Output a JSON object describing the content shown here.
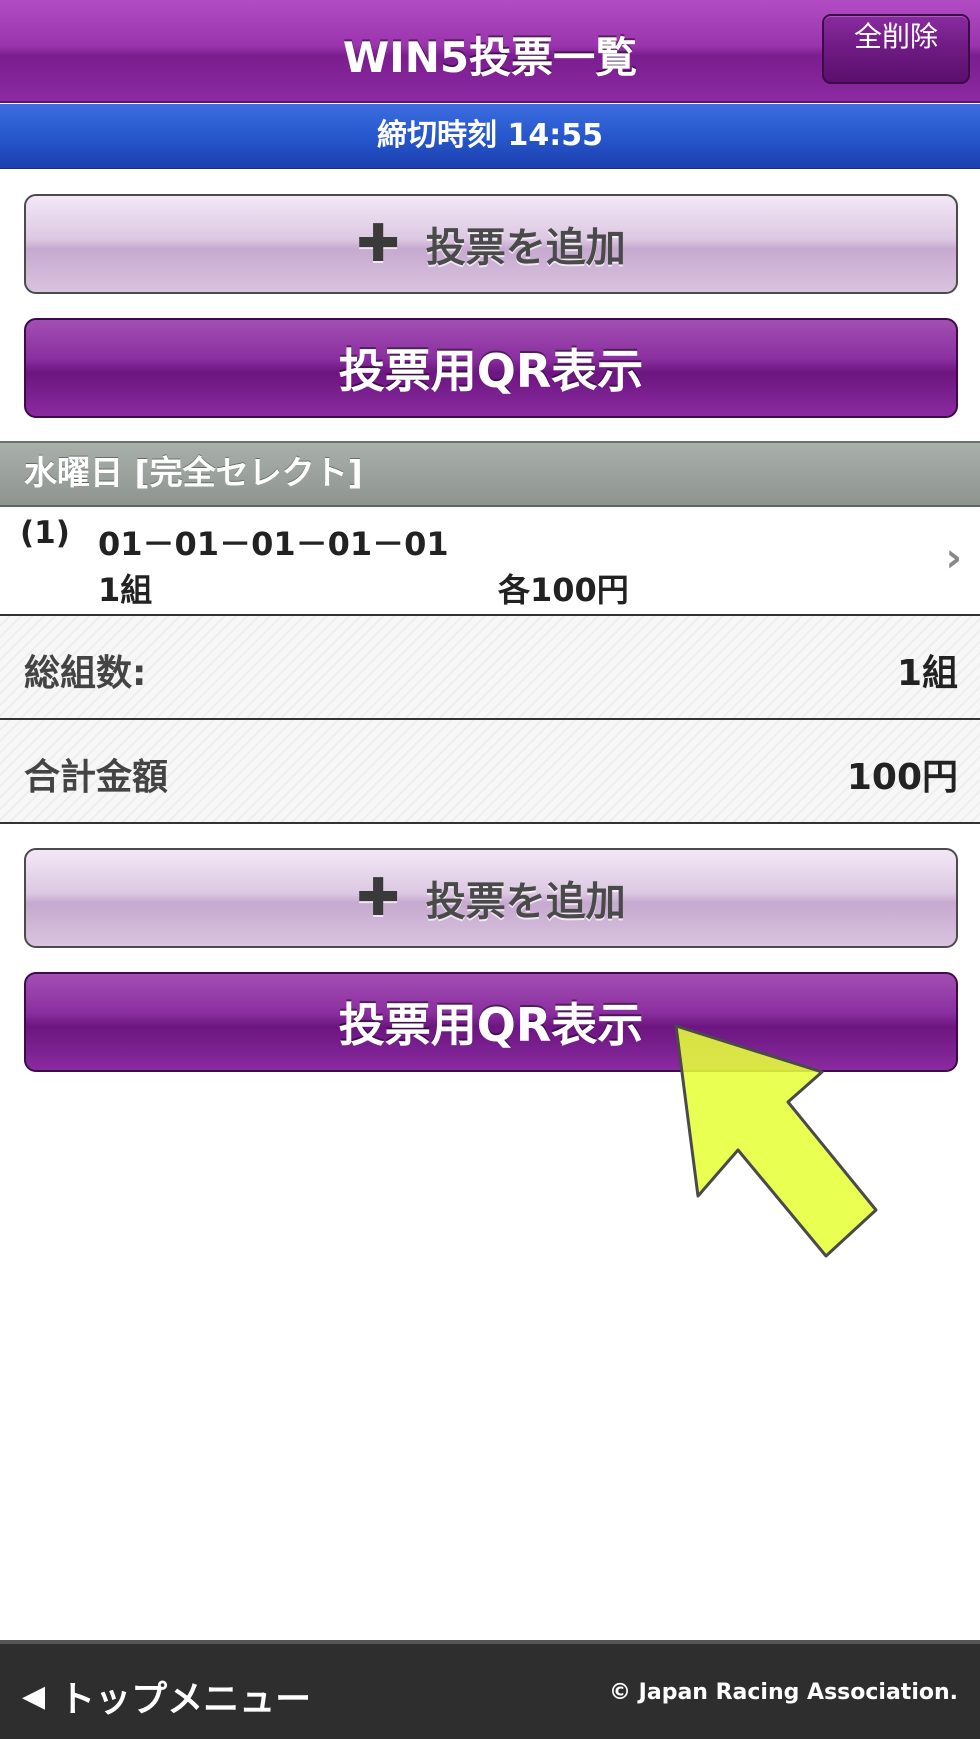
{
  "header": {
    "title": "WIN5投票一覧",
    "delete_all_label": "全削除"
  },
  "deadline": {
    "text": "締切時刻 14:55"
  },
  "actions_top": {
    "add_vote_label": "投票を追加",
    "add_icon": "plus-icon",
    "qr_label": "投票用QR表示"
  },
  "section": {
    "title": "水曜日 [完全セレクト]"
  },
  "bets": [
    {
      "index": "(1)",
      "combination": "01－01－01－01－01",
      "sets": "1組",
      "amount": "各100円"
    }
  ],
  "summary": {
    "total_sets_label": "総組数:",
    "total_sets_value": "1組",
    "total_amount_label": "合計金額",
    "total_amount_value": "100円"
  },
  "actions_bottom": {
    "add_vote_label": "投票を追加",
    "qr_label": "投票用QR表示"
  },
  "footer": {
    "top_menu_label": "トップメニュー",
    "copyright": "© Japan Racing Association."
  },
  "colors": {
    "header_purple": "#9b35ae",
    "deadline_blue": "#2658cc",
    "section_gray": "#8e9590",
    "pointer_yellow": "#e6ff3a"
  }
}
